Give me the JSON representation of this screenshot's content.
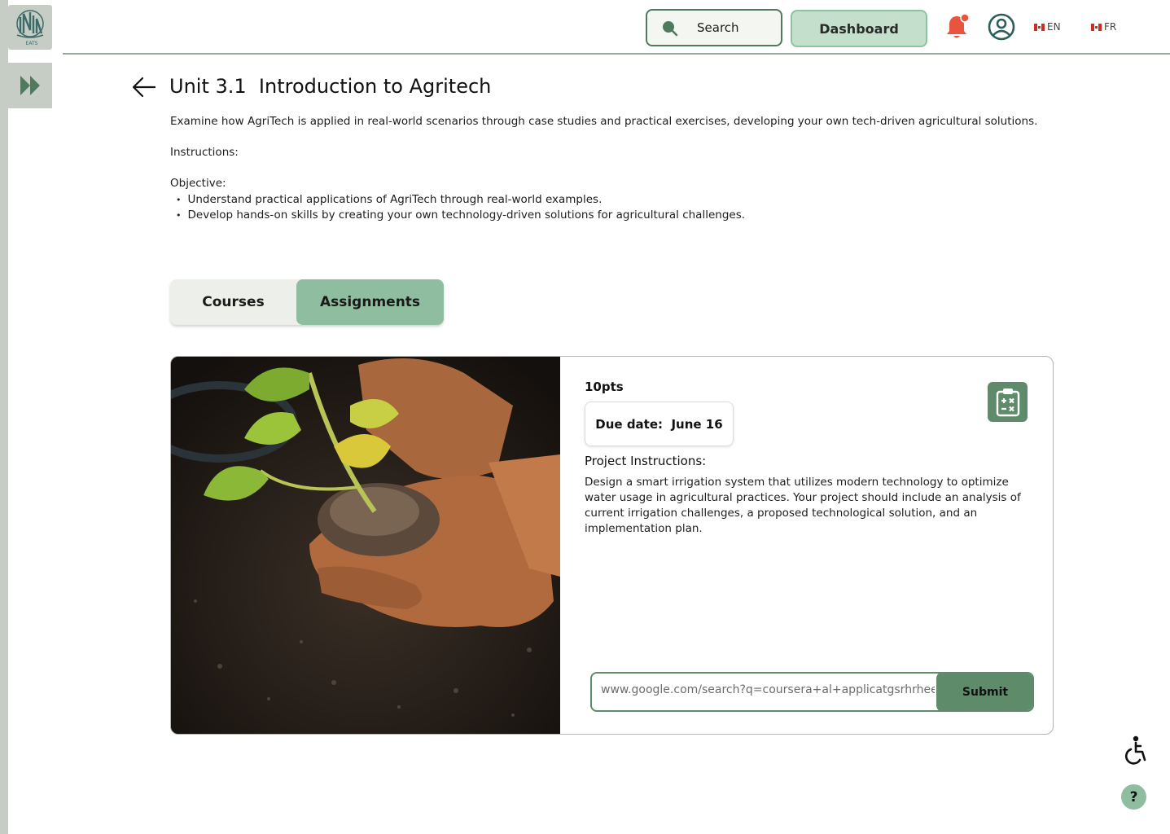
{
  "brand": {
    "logo_text": "EATS"
  },
  "header": {
    "search_label": "Search",
    "dashboard_label": "Dashboard",
    "lang_en": "EN",
    "lang_fr": "FR"
  },
  "page": {
    "title": "Unit 3.1  Introduction to Agritech",
    "description": "Examine how AgriTech is applied in real-world scenarios through case studies and practical exercises, developing your own tech-driven agricultural solutions.",
    "instructions_label": "Instructions:",
    "objective_label": "Objective:",
    "objectives": [
      "Understand practical applications of AgriTech through real-world examples.",
      "Develop hands-on skills by creating your own technology-driven solutions for agricultural challenges."
    ]
  },
  "tabs": [
    {
      "label": "Courses"
    },
    {
      "label": "Assignments",
      "active": true
    }
  ],
  "assignment": {
    "points": "10pts",
    "due_date": "Due date:  June 16",
    "project_heading": "Project Instructions:",
    "project_body": "Design a smart irrigation system that utilizes modern technology to optimize water usage in agricultural practices. Your project should include an analysis of current irrigation challenges, a proposed technological solution, and an implementation plan.",
    "url_value": "www.google.com/search?q=coursera+al+applicatgsrhrheeh",
    "submit_label": "Submit"
  },
  "floating": {
    "help_label": "?"
  },
  "colors": {
    "accent": "#5e8c6b",
    "accent_light": "#8ebda0",
    "rail": "#c5cdc4",
    "notification": "#e8553e"
  }
}
